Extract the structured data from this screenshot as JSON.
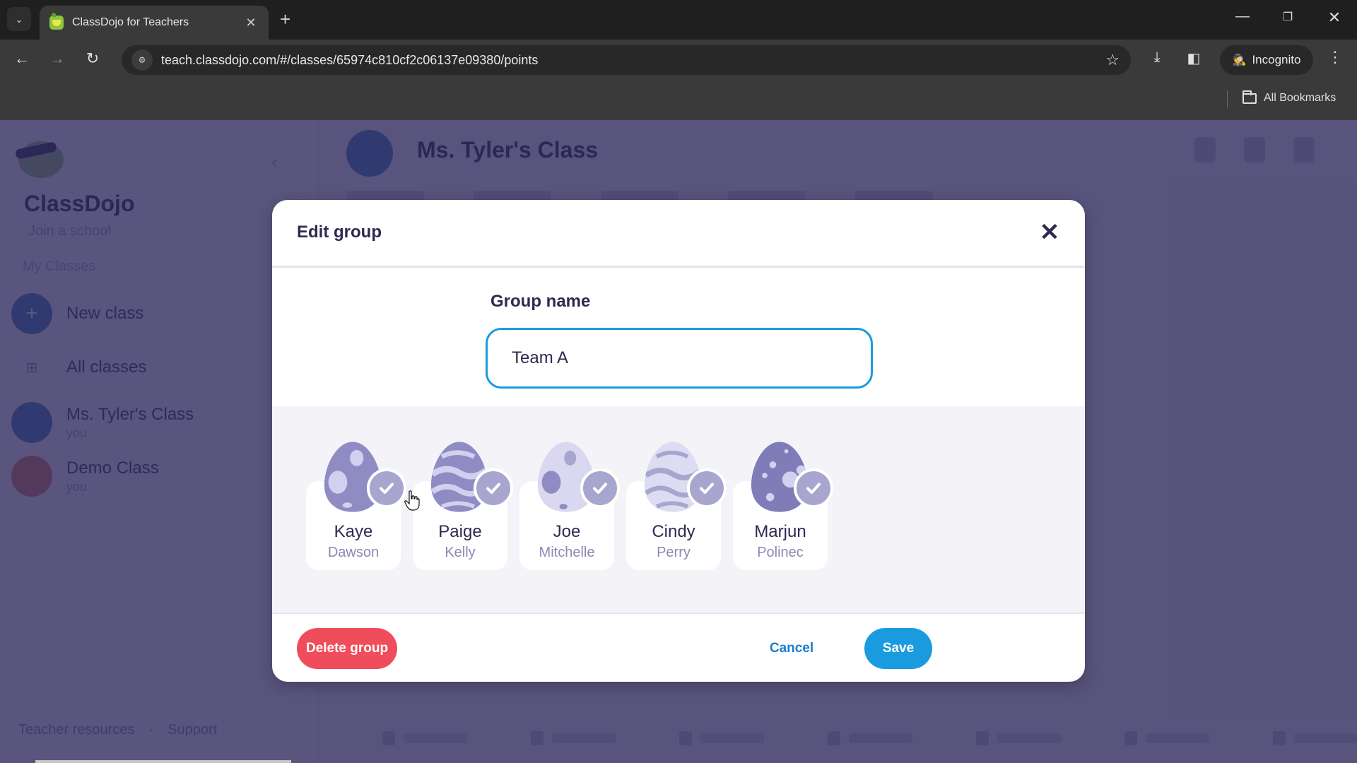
{
  "browser": {
    "tab_title": "ClassDojo for Teachers",
    "url": "teach.classdojo.com/#/classes/65974c810cf2c06137e09380/points",
    "incognito_label": "Incognito",
    "all_bookmarks_label": "All Bookmarks",
    "icons": {
      "tab_search": "⌄",
      "tab_close": "✕",
      "new_tab": "+",
      "minimize": "—",
      "restore": "❐",
      "close": "✕",
      "back": "←",
      "forward": "→",
      "reload": "↻",
      "site_info": "⚙",
      "star": "☆",
      "download": "⤓",
      "side_panel": "◧",
      "incognito": "🕵",
      "menu": "⋮"
    }
  },
  "sidebar": {
    "brand": "ClassDojo",
    "join_school": "Join a school",
    "section_title": "My Classes",
    "new_class": {
      "label": "New class",
      "icon": "+"
    },
    "all_classes": {
      "label": "All classes",
      "icon": "⊞"
    },
    "classes": [
      {
        "name": "Ms. Tyler's Class",
        "owner": "you",
        "color": "#3f7fc0"
      },
      {
        "name": "Demo Class",
        "owner": "you",
        "color": "#e07a5f"
      }
    ],
    "footer": {
      "resources": "Teacher resources",
      "separator": "·",
      "support": "Support"
    }
  },
  "header": {
    "class_title": "Ms. Tyler's Class"
  },
  "modal": {
    "title": "Edit group",
    "close_icon": "✕",
    "group_name_label": "Group name",
    "group_name_value": "Team A",
    "students": [
      {
        "first": "Kaye",
        "last": "Dawson",
        "selected": true,
        "pattern": "spots"
      },
      {
        "first": "Paige",
        "last": "Kelly",
        "selected": true,
        "pattern": "waves"
      },
      {
        "first": "Joe",
        "last": "Mitchelle",
        "selected": true,
        "pattern": "spots-light"
      },
      {
        "first": "Cindy",
        "last": "Perry",
        "selected": true,
        "pattern": "waves-light"
      },
      {
        "first": "Marjun",
        "last": "Polinec",
        "selected": true,
        "pattern": "hexes"
      }
    ],
    "delete_label": "Delete group",
    "cancel_label": "Cancel",
    "save_label": "Save"
  },
  "colors": {
    "primary_blue": "#1a9be0",
    "cancel_blue": "#1a7ecf",
    "delete_red": "#ef4d5b",
    "check_purple": "#a8a6cf",
    "text_dark": "#2c2a50",
    "overlay": "#2c265a"
  }
}
